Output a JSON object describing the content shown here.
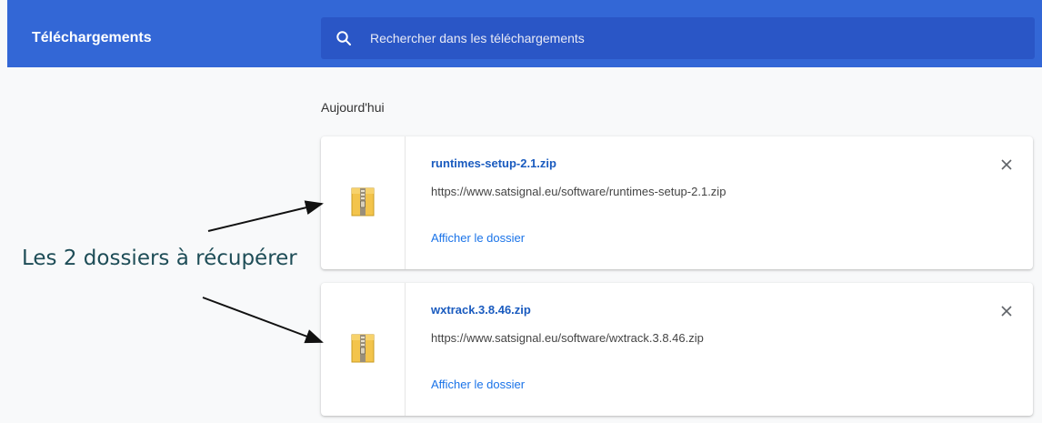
{
  "header": {
    "title": "Téléchargements",
    "search_placeholder": "Rechercher dans les téléchargements"
  },
  "section": {
    "title": "Aujourd'hui"
  },
  "downloads": [
    {
      "name": "runtimes-setup-2.1.zip",
      "url": "https://www.satsignal.eu/software/runtimes-setup-2.1.zip",
      "action": "Afficher le dossier"
    },
    {
      "name": "wxtrack.3.8.46.zip",
      "url": "https://www.satsignal.eu/software/wxtrack.3.8.46.zip",
      "action": "Afficher le dossier"
    }
  ],
  "annotation": {
    "text": "Les 2 dossiers à récupérer"
  },
  "icons": {
    "search": "search-icon",
    "file": "zip-archive-icon",
    "close": "close-icon"
  },
  "colors": {
    "header_bg": "#3367d6",
    "search_bg": "#2a56c6",
    "link": "#1a73e8",
    "annotation": "#1e4d57"
  }
}
